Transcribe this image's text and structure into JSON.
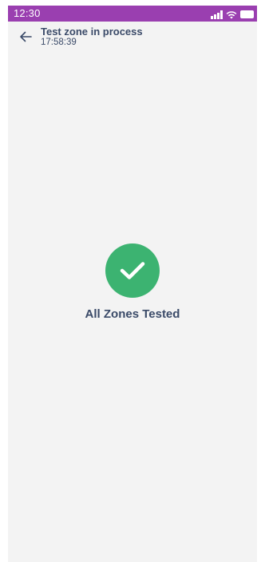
{
  "status_bar": {
    "time": "12:30",
    "icons": [
      "signal-icon",
      "wifi-icon",
      "battery-icon"
    ],
    "color": "#9a3fb0"
  },
  "app_bar": {
    "back_icon": "arrow-left-icon",
    "title": "Test zone in process",
    "subtitle": "17:58:39"
  },
  "result": {
    "icon": "check-icon",
    "icon_color": "#3cb371",
    "message": "All Zones Tested"
  },
  "colors": {
    "text_primary": "#3a4a68",
    "background": "#f3f3f3"
  }
}
